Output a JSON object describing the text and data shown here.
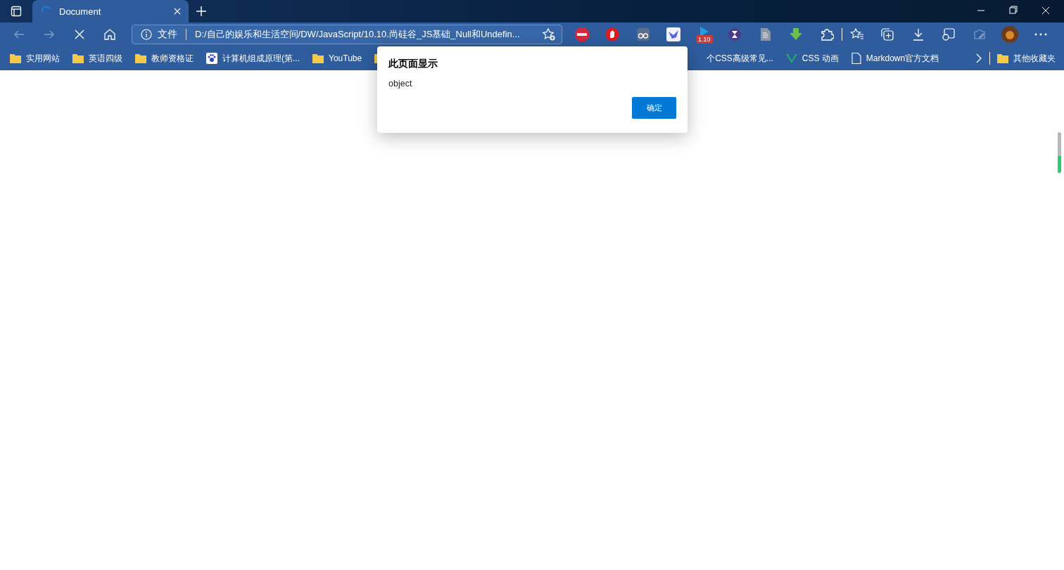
{
  "tab": {
    "title": "Document",
    "loading": true
  },
  "address_bar": {
    "scheme_label": "文件",
    "url": "D:/自己的娱乐和生活空间/DW/JavaScript/10.10.尚硅谷_JS基础_Null和Undefin..."
  },
  "extension_badge": "1.10",
  "bookmarks": [
    {
      "kind": "folder",
      "label": "实用网站"
    },
    {
      "kind": "folder",
      "label": "英语四级"
    },
    {
      "kind": "folder",
      "label": "教师资格证"
    },
    {
      "kind": "paw",
      "label": "计算机组成原理(第..."
    },
    {
      "kind": "folder",
      "label": "YouTube"
    },
    {
      "kind": "folder"
    },
    {
      "kind": "covered",
      "label": "个CSS高级常见..."
    },
    {
      "kind": "vue",
      "label": "CSS 动画"
    },
    {
      "kind": "page",
      "label": "Markdown官方文档"
    }
  ],
  "other_bookmarks": "其他收藏夹",
  "dialog": {
    "title": "此页面显示",
    "message": "object",
    "button": "确定"
  }
}
